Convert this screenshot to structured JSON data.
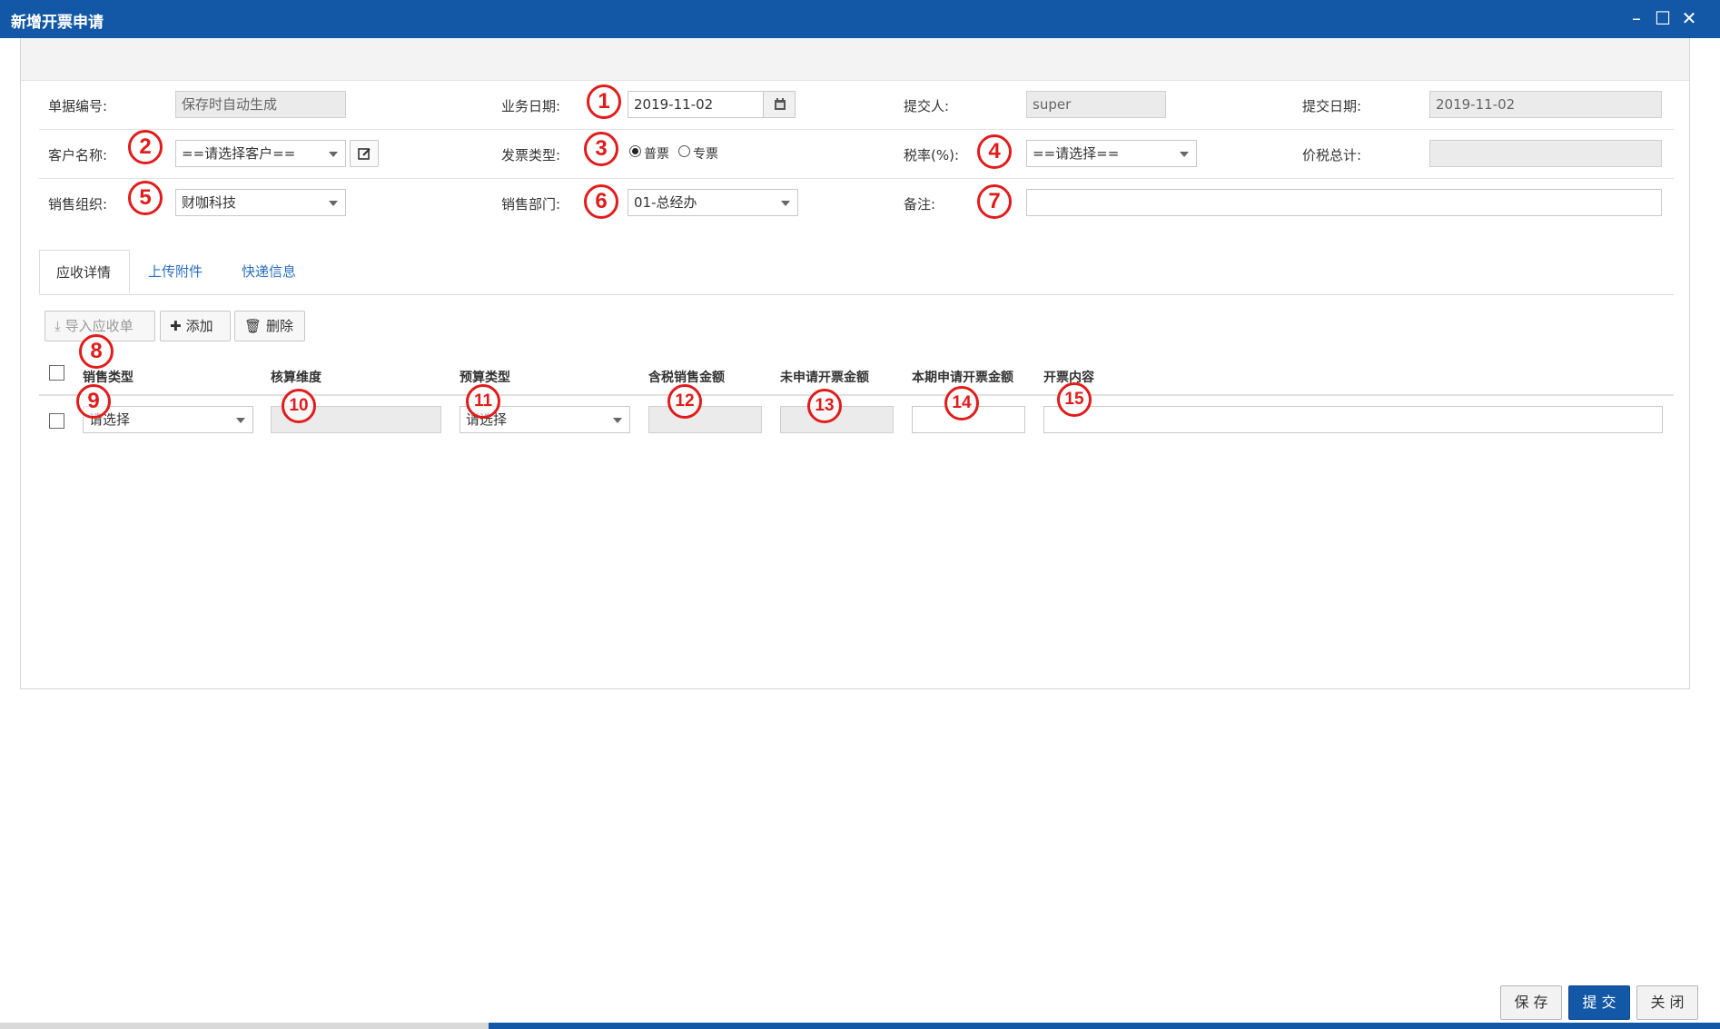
{
  "window": {
    "title": "新增开票申请",
    "minimize": "–",
    "maximize": "☐",
    "close": "✕"
  },
  "form": {
    "doc_no": {
      "label": "单据编号:",
      "value": "保存时自动生成"
    },
    "biz_date": {
      "label": "业务日期:",
      "value": "2019-11-02"
    },
    "submitter": {
      "label": "提交人:",
      "value": "super"
    },
    "submit_date": {
      "label": "提交日期:",
      "value": "2019-11-02"
    },
    "customer": {
      "label": "客户名称:",
      "value": "==请选择客户=="
    },
    "invoice_type": {
      "label": "发票类型:",
      "options": [
        "普票",
        "专票"
      ],
      "selected": "普票"
    },
    "tax_rate": {
      "label": "税率(%):",
      "value": "==请选择=="
    },
    "total": {
      "label": "价税总计:",
      "value": ""
    },
    "sales_org": {
      "label": "销售组织:",
      "value": "财咖科技"
    },
    "sales_dept": {
      "label": "销售部门:",
      "value": "01-总经办"
    },
    "remark": {
      "label": "备注:",
      "value": ""
    }
  },
  "tabs": [
    {
      "label": "应收详情",
      "active": true
    },
    {
      "label": "上传附件",
      "active": false
    },
    {
      "label": "快递信息",
      "active": false
    }
  ],
  "toolbar": {
    "import": "导入应收单",
    "add": "添加",
    "delete": "删除"
  },
  "table": {
    "headers": [
      "销售类型",
      "核算维度",
      "预算类型",
      "含税销售金额",
      "未申请开票金额",
      "本期申请开票金额",
      "开票内容"
    ],
    "row": {
      "sales_type": "请选择",
      "dimension": "",
      "budget_type": "请选择",
      "amount_with_tax": "",
      "unapplied": "",
      "this_period": "",
      "content": ""
    }
  },
  "markers": [
    "1",
    "2",
    "3",
    "4",
    "5",
    "6",
    "7",
    "8",
    "9",
    "10",
    "11",
    "12",
    "13",
    "14",
    "15"
  ],
  "footer": {
    "save": "保 存",
    "submit": "提 交",
    "close": "关 闭"
  },
  "colors": {
    "title_bar": "#1358a6",
    "marker": "#e21b1b",
    "link": "#2a6fc0"
  }
}
